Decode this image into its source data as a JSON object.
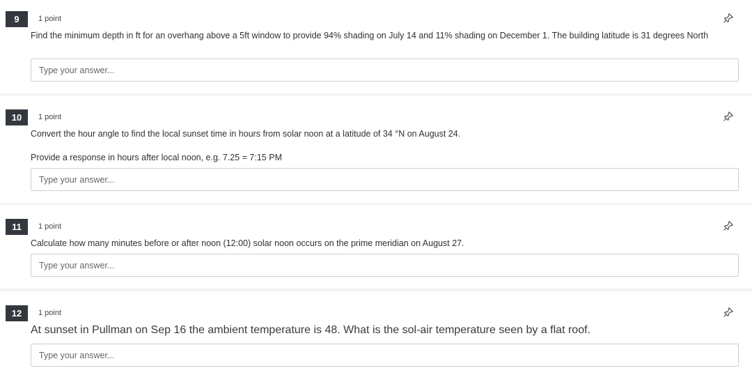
{
  "questions": [
    {
      "number": "9",
      "points": "1 point",
      "text": "Find the minimum depth in ft for an overhang above a 5ft window to provide 94% shading on July 14 and 11% shading on December 1. The building latitude is 31 degrees North",
      "placeholder": "Type your answer..."
    },
    {
      "number": "10",
      "points": "1 point",
      "text": "Convert the hour angle to find the local sunset time in hours from solar noon at a latitude of 34 °N on August 24.",
      "text2": "Provide a response in hours after local noon, e.g. 7.25 = 7:15 PM",
      "placeholder": "Type your answer..."
    },
    {
      "number": "11",
      "points": "1 point",
      "text": "Calculate how many minutes before or after noon (12:00) solar noon occurs on the prime meridian on August 27.",
      "placeholder": "Type your answer..."
    },
    {
      "number": "12",
      "points": "1 point",
      "text": "At sunset in Pullman on Sep 16 the ambient temperature is 48. What is the sol-air temperature seen by a flat roof.",
      "placeholder": "Type your answer..."
    }
  ],
  "icons": {
    "pin": "pin-icon"
  }
}
